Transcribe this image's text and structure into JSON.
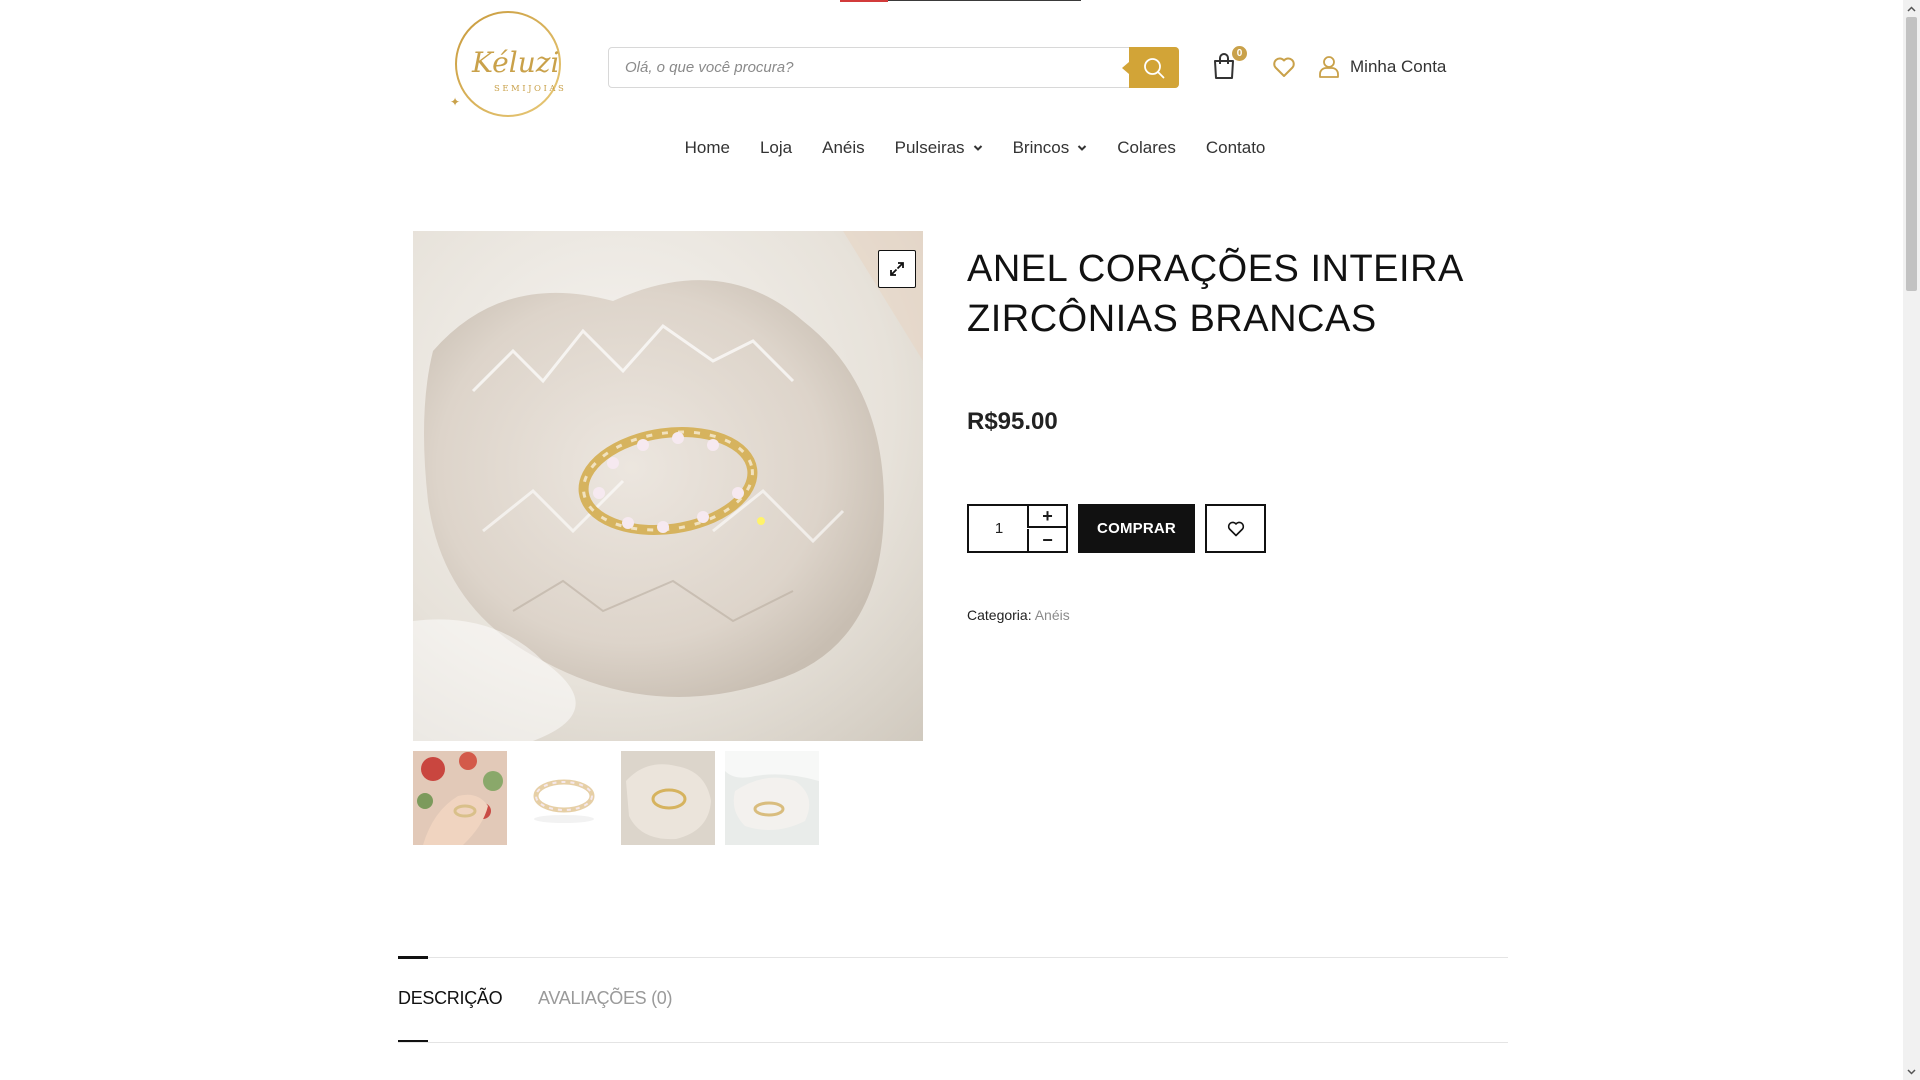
{
  "colors": {
    "accent": "#d2a437",
    "text": "#111111",
    "muted": "#8b8b8b",
    "badge": "#c9a14a"
  },
  "header": {
    "logo": {
      "script": "Kéluzi",
      "subtitle": "SEMIJOIAS"
    },
    "search": {
      "placeholder": "Olá, o que você procura?",
      "value": "",
      "button_icon": "search-icon"
    },
    "cart": {
      "icon": "shopping-bag-icon",
      "count": "0"
    },
    "wishlist_icon": "heart-icon",
    "account": {
      "icon": "user-icon",
      "label": "Minha Conta"
    }
  },
  "nav": {
    "items": [
      {
        "label": "Home",
        "has_dropdown": false
      },
      {
        "label": "Loja",
        "has_dropdown": false
      },
      {
        "label": "Anéis",
        "has_dropdown": false
      },
      {
        "label": "Pulseiras",
        "has_dropdown": true
      },
      {
        "label": "Brincos",
        "has_dropdown": true
      },
      {
        "label": "Colares",
        "has_dropdown": false
      },
      {
        "label": "Contato",
        "has_dropdown": false
      }
    ]
  },
  "product": {
    "title_line1": "ANEL CORAÇÕES INTEIRA",
    "title_line2": "ZIRCÔNIAS BRANCAS",
    "price": "R$95.00",
    "quantity": "1",
    "qty_plus": "+",
    "qty_minus": "−",
    "buy_label": "COMPRAR",
    "category_label": "Categoria:",
    "category_value": "Anéis",
    "zoom_icon": "expand-icon",
    "thumbnails": [
      "thumb-hand",
      "thumb-white",
      "thumb-crystal",
      "thumb-stone"
    ]
  },
  "tabs": [
    {
      "label": "DESCRIÇÃO",
      "active": true
    },
    {
      "label": "AVALIAÇÕES (0)",
      "active": false
    }
  ]
}
